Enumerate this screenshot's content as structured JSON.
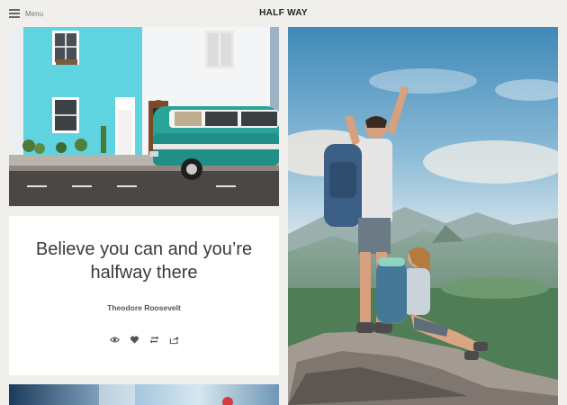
{
  "header": {
    "menu_label": "Menu",
    "brand": "HALF WAY"
  },
  "feed": {
    "quote_card": {
      "quote": "Believe you can and you’re halfway there",
      "author": "Theodore Roosevelt",
      "actions": [
        {
          "icon": "eye-icon",
          "name": "view"
        },
        {
          "icon": "heart-icon",
          "name": "like"
        },
        {
          "icon": "reblog-icon",
          "name": "reblog"
        },
        {
          "icon": "share-icon",
          "name": "share"
        }
      ]
    }
  },
  "colors": {
    "background": "#f1efec",
    "card": "#ffffff",
    "text": "#3a3a3a"
  }
}
